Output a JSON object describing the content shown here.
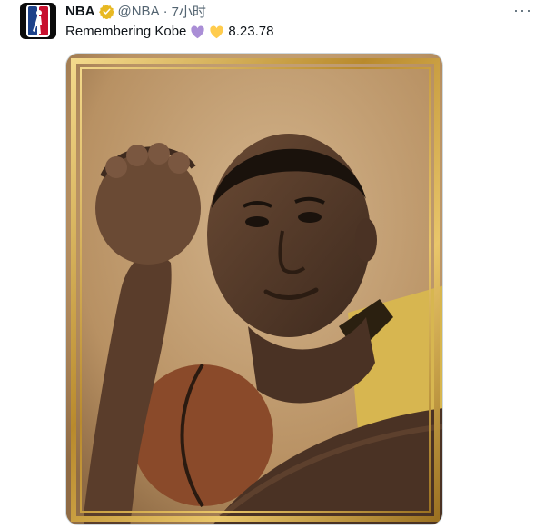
{
  "tweet": {
    "author_name": "NBA",
    "handle": "@NBA",
    "separator": "·",
    "time": "7小时",
    "more_label": "···",
    "text": "Remembering Kobe",
    "date_text": "8.23.78",
    "emoji": [
      "purple-heart",
      "yellow-heart"
    ],
    "media_alt": "Portrait photo of Kobe Bryant in a gold frame"
  },
  "colors": {
    "verified": "#e8b923",
    "purple_heart": "#aa8ed6",
    "yellow_heart": "#ffcc4d",
    "frame_gold": "#c9a23c"
  },
  "icons": {
    "avatar": "nba-logo-icon",
    "verified": "verified-badge-icon",
    "more": "more-options-icon"
  }
}
